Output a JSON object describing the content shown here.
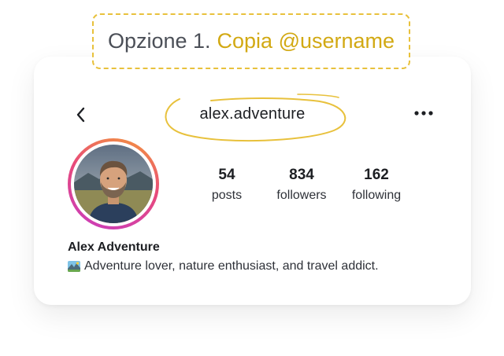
{
  "callout": {
    "prefix": "Opzione 1.",
    "accent": "Copia @username",
    "accent_color": "#d2a913",
    "border_color": "#e8c13c"
  },
  "profile": {
    "username": "alex.adventure",
    "back_icon": "chevron-left-icon",
    "more_icon": "more-horizontal-icon",
    "stats": [
      {
        "value": "54",
        "label": "posts"
      },
      {
        "value": "834",
        "label": "followers"
      },
      {
        "value": "162",
        "label": "following"
      }
    ],
    "display_name": "Alex Adventure",
    "bio_emoji": "national-park-emoji",
    "bio_text": "Adventure lover, nature enthusiast, and travel addict."
  },
  "colors": {
    "ring_gradient": [
      "#f39a3a",
      "#e84a7a",
      "#c83cc0"
    ],
    "highlight_ellipse": "#e8c13c"
  }
}
